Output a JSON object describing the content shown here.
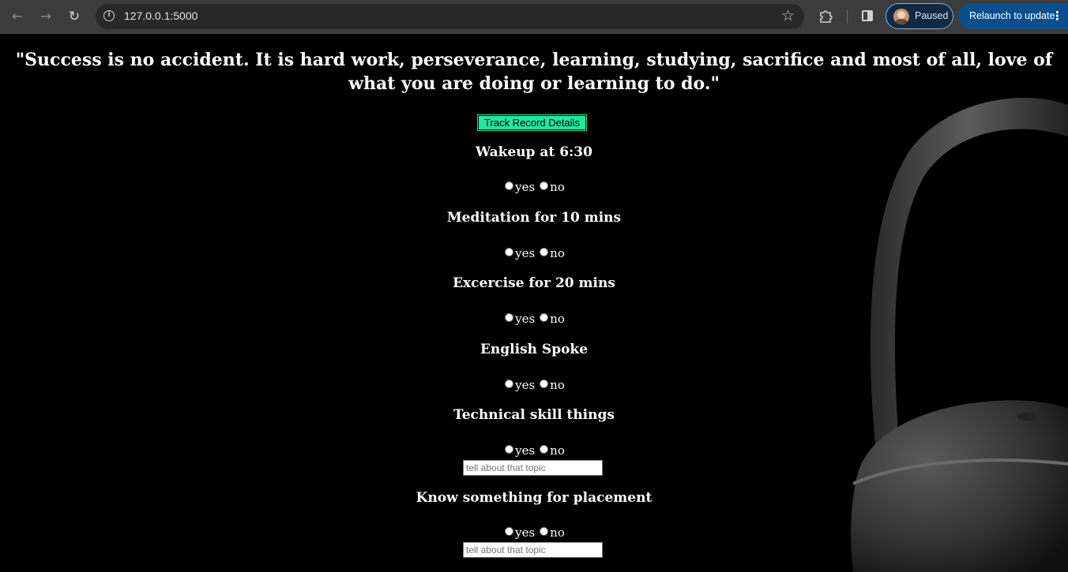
{
  "browser": {
    "url": "127.0.0.1:5000",
    "profile_status": "Paused",
    "relaunch_label": "Relaunch to update",
    "icons": [
      "back-icon",
      "forward-icon",
      "reload-icon",
      "site-info-icon",
      "star-icon",
      "extensions-icon",
      "side-panel-icon",
      "menu-icon"
    ]
  },
  "page": {
    "quote": "\"Success is no accident. It is hard work, perseverance, learning, studying, sacrifice and most of all, love of what you are doing or learning to do.\"",
    "track_button_label": "Track Record Details",
    "accent_color": "#1de9a0",
    "questions": [
      {
        "title": "Wakeup at 6:30",
        "yes": "yes",
        "no": "no"
      },
      {
        "title": "Meditation for 10 mins",
        "yes": "yes",
        "no": "no"
      },
      {
        "title": "Excercise for 20 mins",
        "yes": "yes",
        "no": "no"
      },
      {
        "title": "English Spoke",
        "yes": "yes",
        "no": "no"
      },
      {
        "title": "Technical skill things",
        "yes": "yes",
        "no": "no",
        "input_placeholder": "tell about that topic",
        "input_value": ""
      },
      {
        "title": "Know something for placement",
        "yes": "yes",
        "no": "no",
        "input_placeholder": "tell about that topic",
        "input_value": ""
      }
    ]
  }
}
